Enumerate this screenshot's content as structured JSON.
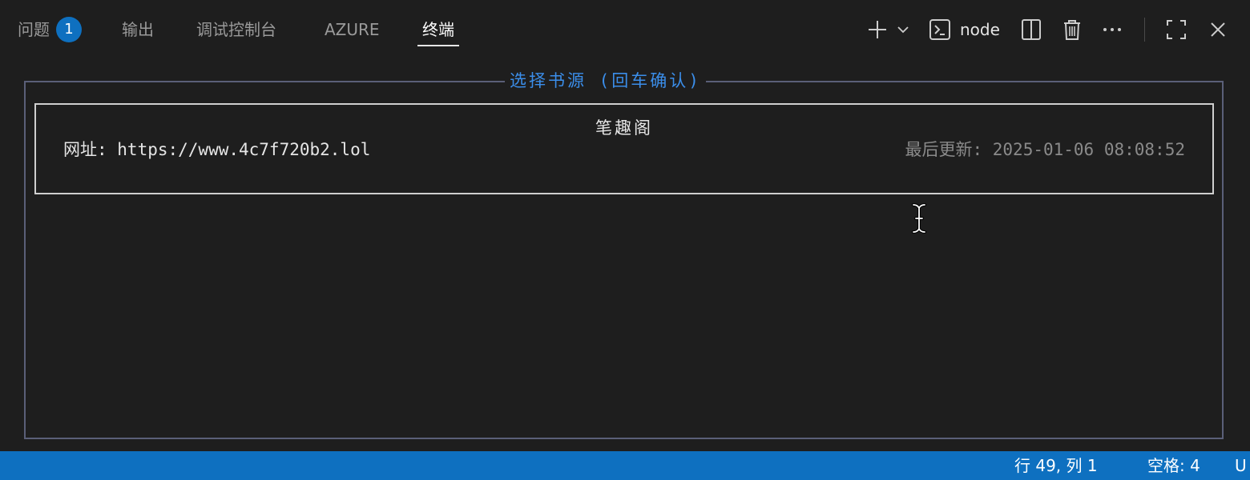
{
  "tabs": [
    {
      "label": "问题",
      "badge": "1"
    },
    {
      "label": "输出"
    },
    {
      "label": "调试控制台"
    },
    {
      "label": "AZURE"
    },
    {
      "label": "终端",
      "active": true
    }
  ],
  "toolbar": {
    "terminal_name": "node",
    "icons": [
      "plus-icon",
      "chevron-down-icon",
      "terminal-icon",
      "split-editor-icon",
      "trash-icon",
      "more-icon",
      "maximize-icon",
      "close-icon"
    ]
  },
  "terminal": {
    "frame_title": "选择书源 (回车确认)",
    "source": {
      "name": "笔趣阁",
      "url": "网址: https://www.4c7f720b2.lol",
      "updated": "最后更新: 2025-01-06 08:08:52"
    }
  },
  "status": {
    "position": "行 49, 列 1",
    "indent": "空格: 4",
    "encoding": "U"
  },
  "colors": {
    "background": "#1e1e1e",
    "accent": "#0e70c0",
    "frame_title": "#3b8eea",
    "frame_border": "#5a5f78"
  }
}
